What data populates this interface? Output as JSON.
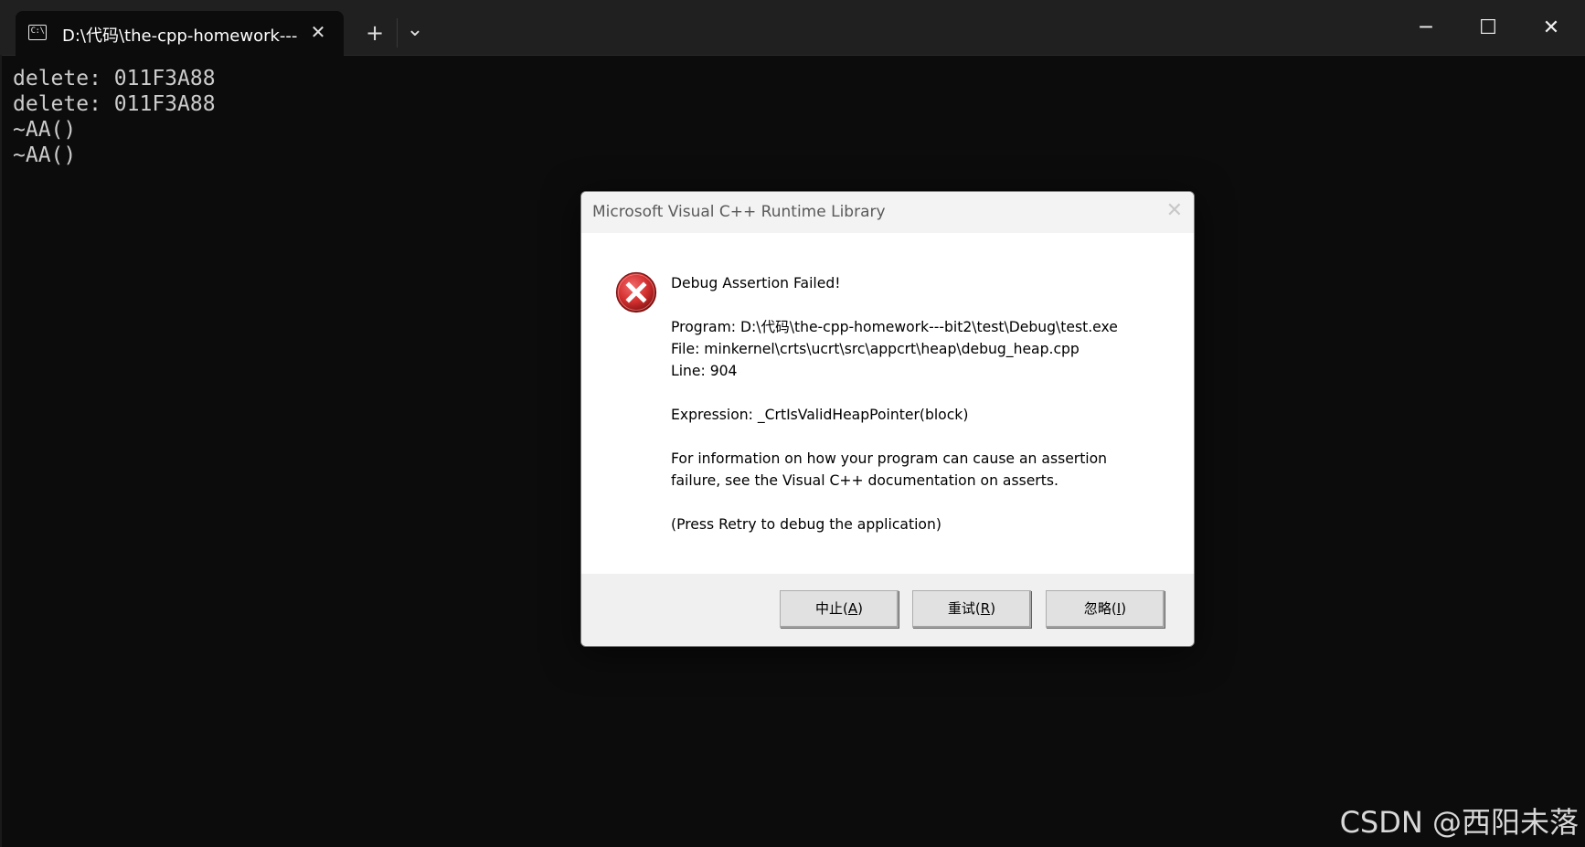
{
  "window": {
    "tab_title": "D:\\代码\\the-cpp-homework---",
    "tab_icon_text": "C:\\",
    "tab_close": "✕",
    "new_tab": "+",
    "dropdown": "⌄",
    "minimize": "─",
    "maximize": "☐",
    "close": "✕"
  },
  "console": {
    "lines": [
      "delete: 011F3A88",
      "delete: 011F3A88",
      "~AA()",
      "~AA()"
    ]
  },
  "dialog": {
    "title": "Microsoft Visual C++ Runtime Library",
    "close": "✕",
    "heading": "Debug Assertion Failed!",
    "program": "Program: D:\\代码\\the-cpp-homework---bit2\\test\\Debug\\test.exe",
    "file": "File: minkernel\\crts\\ucrt\\src\\appcrt\\heap\\debug_heap.cpp",
    "line": "Line: 904",
    "expression": "Expression: _CrtIsValidHeapPointer(block)",
    "info_1": "For information on how your program can cause an assertion",
    "info_2": "failure, see the Visual C++ documentation on asserts.",
    "retry_hint": "(Press Retry to debug the application)",
    "buttons": {
      "abort": {
        "label": "中止(",
        "key": "A",
        "end": ")"
      },
      "retry": {
        "label": "重试(",
        "key": "R",
        "end": ")"
      },
      "ignore": {
        "label": "忽略(",
        "key": "I",
        "end": ")"
      }
    }
  },
  "watermark": "CSDN @西阳未落",
  "colors": {
    "terminal_bg": "#0c0c0c",
    "titlebar_bg": "#202020",
    "error_red": "#d32f2f"
  }
}
